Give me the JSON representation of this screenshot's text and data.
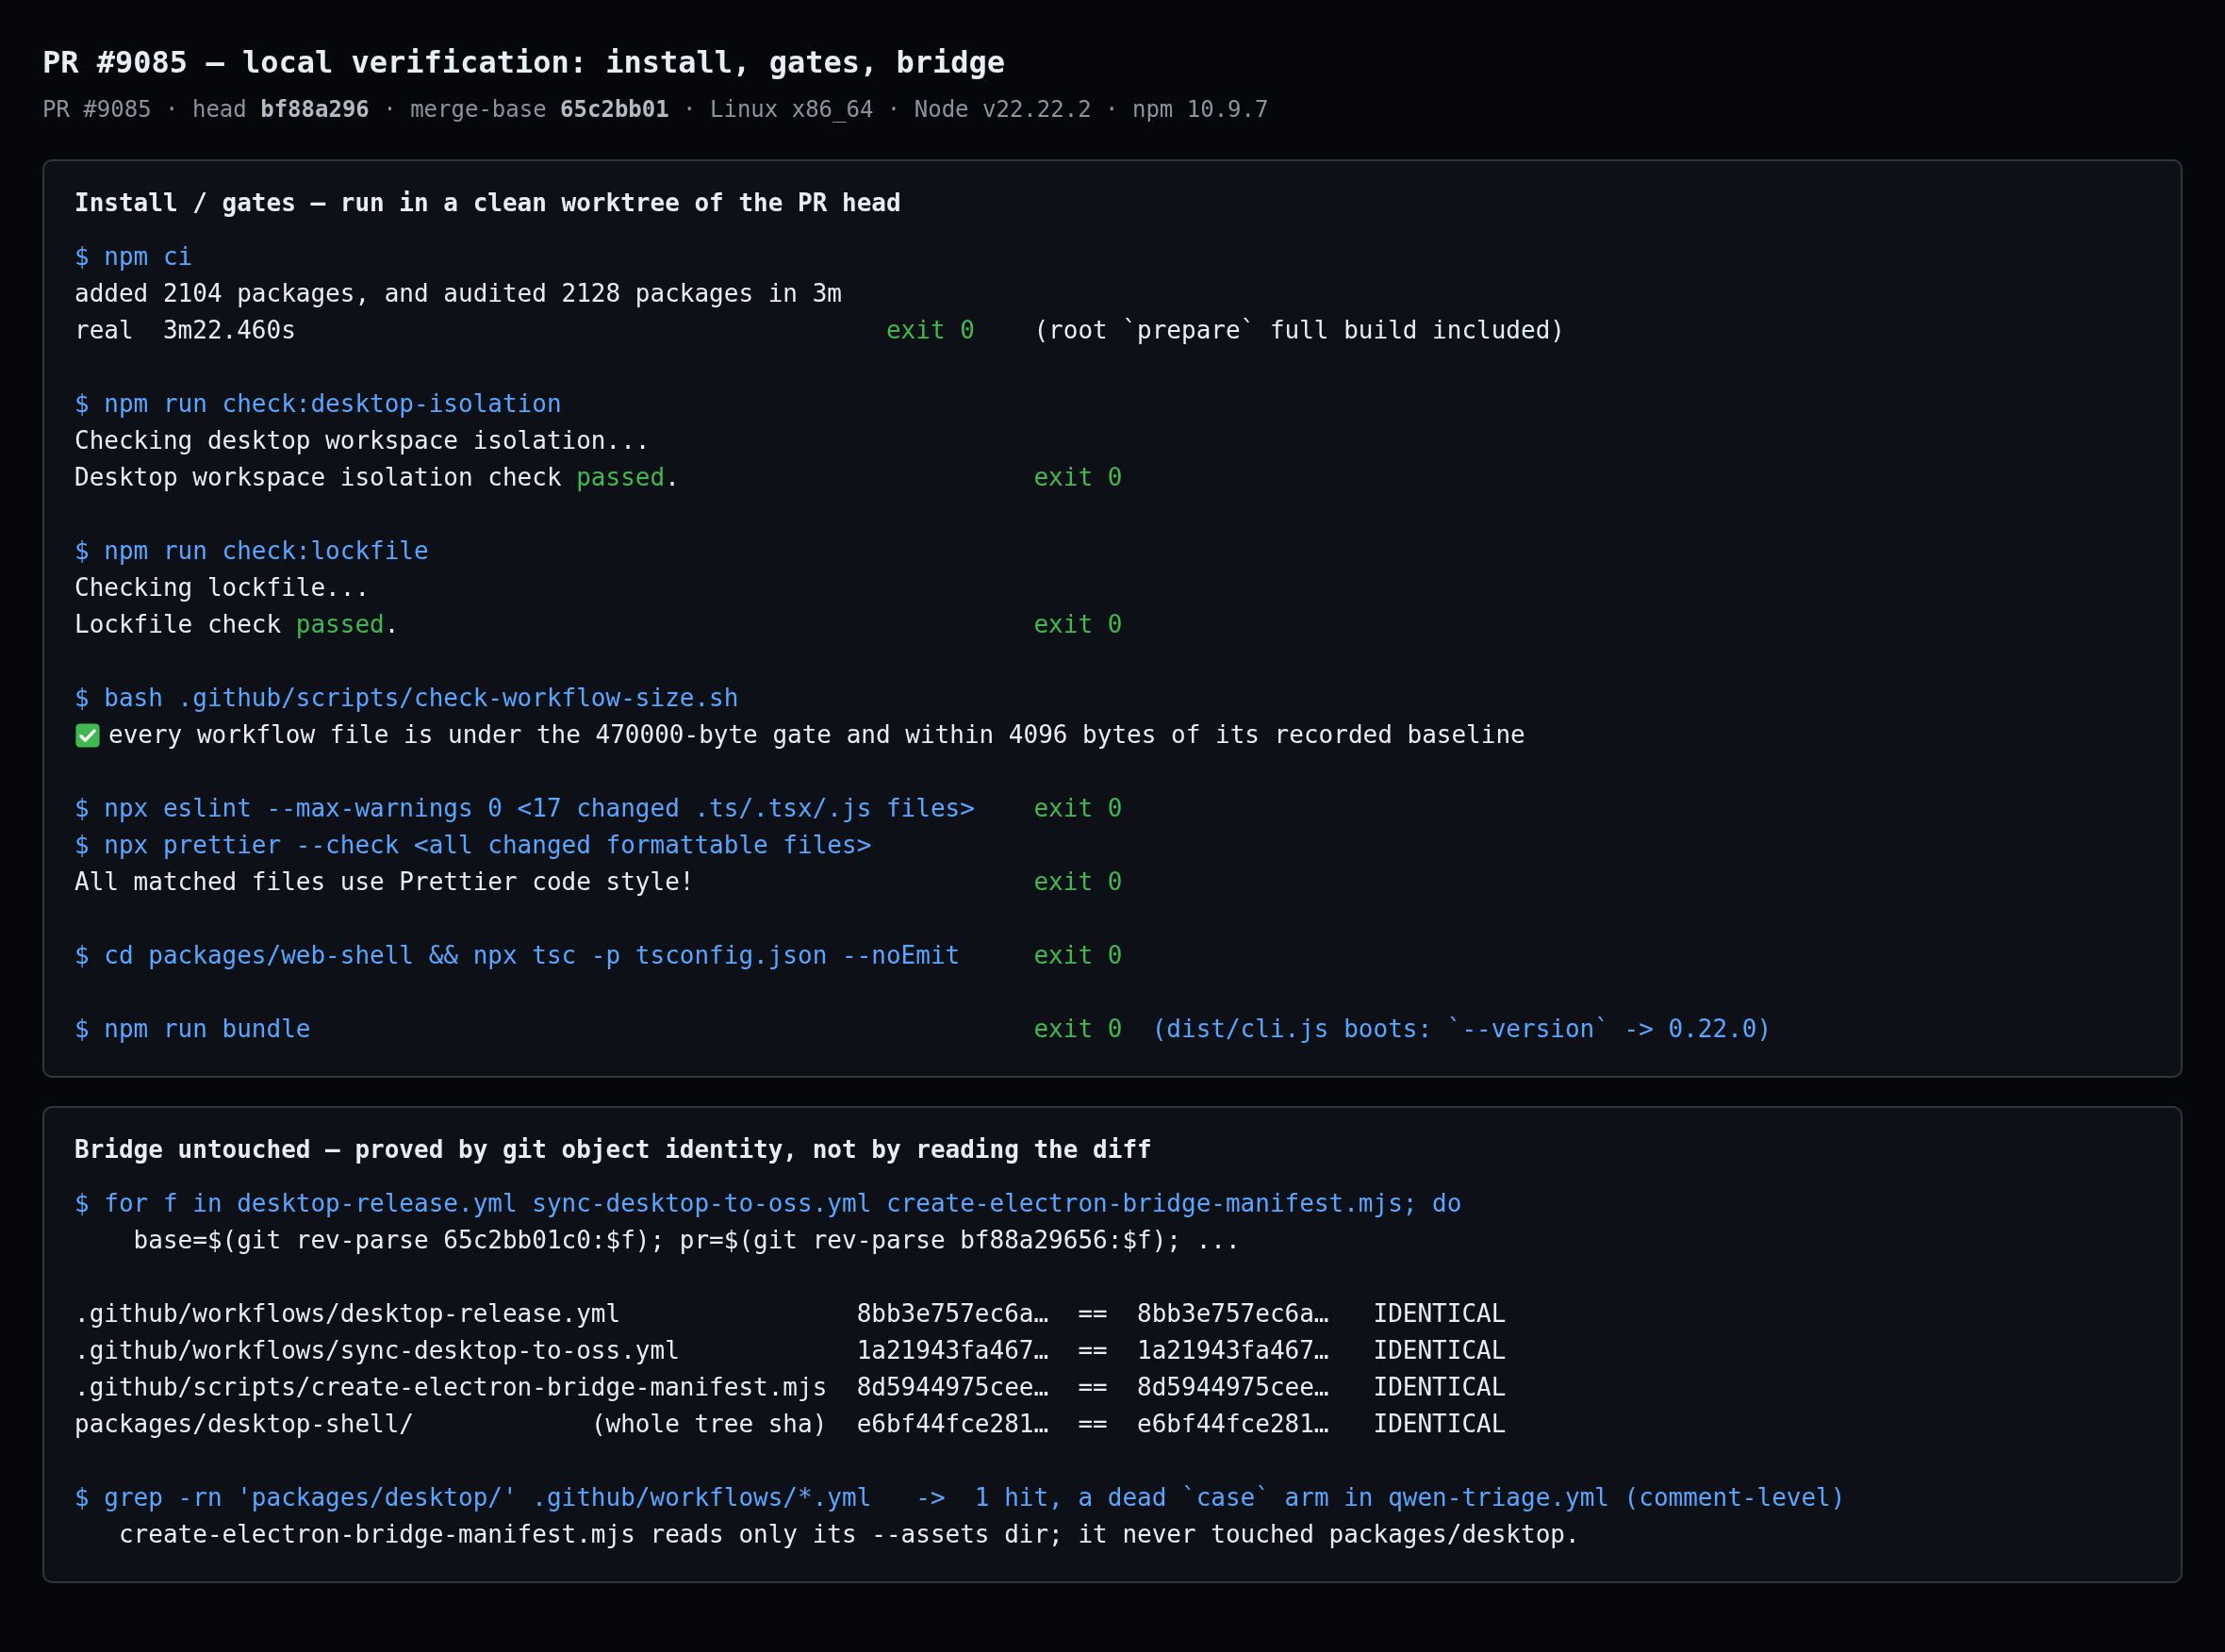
{
  "title": "PR #9085 — local verification: install, gates, bridge",
  "subtitle": "PR #9085 · head **bf88a296** · merge-base **65c2bb01** · Linux x86_64 · Node v22.22.2 · npm 10.9.7",
  "panels": [
    {
      "heading": "Install / gates — run in a clean worktree of the PR head",
      "lines": [
        {
          "kind": "flow",
          "parts": [
            {
              "text": "$ npm ci",
              "kind": "command"
            }
          ]
        },
        {
          "kind": "flow",
          "parts": [
            {
              "text": "added 2104 packages, and audited 2128 packages in 3m",
              "kind": "output"
            }
          ]
        },
        {
          "kind": "timed",
          "parts": [
            {
              "text": "real  3m22.460s",
              "kind": "output"
            }
          ],
          "status": "exit 0",
          "note": {
            "text": "(root `prepare` full build included)",
            "kind": "output"
          }
        },
        {
          "kind": "blank"
        },
        {
          "kind": "flow",
          "parts": [
            {
              "text": "$ npm run check:desktop-isolation",
              "kind": "command"
            }
          ]
        },
        {
          "kind": "flow",
          "parts": [
            {
              "text": "Checking desktop workspace isolation...",
              "kind": "output"
            }
          ]
        },
        {
          "kind": "gated",
          "parts": [
            {
              "text": "Desktop workspace isolation check ",
              "kind": "output"
            },
            {
              "text": "passed",
              "kind": "ok"
            },
            {
              "text": ".",
              "kind": "output"
            }
          ],
          "status": "exit 0"
        },
        {
          "kind": "blank"
        },
        {
          "kind": "flow",
          "parts": [
            {
              "text": "$ npm run check:lockfile",
              "kind": "command"
            }
          ]
        },
        {
          "kind": "flow",
          "parts": [
            {
              "text": "Checking lockfile...",
              "kind": "output"
            }
          ]
        },
        {
          "kind": "gated",
          "parts": [
            {
              "text": "Lockfile check ",
              "kind": "output"
            },
            {
              "text": "passed",
              "kind": "ok"
            },
            {
              "text": ".",
              "kind": "output"
            }
          ],
          "status": "exit 0"
        },
        {
          "kind": "blank"
        },
        {
          "kind": "flow",
          "parts": [
            {
              "text": "$ bash .github/scripts/check-workflow-size.sh",
              "kind": "command"
            }
          ]
        },
        {
          "kind": "checked",
          "parts": [
            {
              "text": "every workflow file is under the 470000-byte gate and within 4096 bytes of its recorded baseline",
              "kind": "output"
            }
          ]
        },
        {
          "kind": "blank"
        },
        {
          "kind": "gated",
          "parts": [
            {
              "text": "$ npx eslint --max-warnings 0 <17 changed .ts/.tsx/.js files>",
              "kind": "command"
            }
          ],
          "status": "exit 0"
        },
        {
          "kind": "flow",
          "parts": [
            {
              "text": "$ npx prettier --check <all changed formattable files>",
              "kind": "command"
            }
          ]
        },
        {
          "kind": "gated",
          "parts": [
            {
              "text": "All matched files use Prettier code style!",
              "kind": "output"
            }
          ],
          "status": "exit 0"
        },
        {
          "kind": "blank"
        },
        {
          "kind": "gated",
          "parts": [
            {
              "text": "$ cd packages/web-shell && npx tsc -p tsconfig.json --noEmit",
              "kind": "command"
            }
          ],
          "status": "exit 0"
        },
        {
          "kind": "blank"
        },
        {
          "kind": "gated",
          "parts": [
            {
              "text": "$ npm run bundle",
              "kind": "command"
            }
          ],
          "status": "exit 0",
          "note": {
            "text": "(dist/cli.js boots: `--version` -> 0.22.0)",
            "kind": "command"
          }
        }
      ]
    },
    {
      "heading": "Bridge untouched — proved by git object identity, not by reading the diff",
      "lines": [
        {
          "kind": "flow",
          "parts": [
            {
              "text": "$ for f in desktop-release.yml sync-desktop-to-oss.yml create-electron-bridge-manifest.mjs; do",
              "kind": "command"
            }
          ]
        },
        {
          "kind": "flow",
          "parts": [
            {
              "text": "    base=$(git rev-parse 65c2bb01c0:$f); pr=$(git rev-parse bf88a29656:$f); ...",
              "kind": "output"
            }
          ]
        },
        {
          "kind": "blank"
        },
        {
          "kind": "table",
          "path": ".github/workflows/desktop-release.yml",
          "base": "8bb3e757ec6a…",
          "sep": "==",
          "head": "8bb3e757ec6a…",
          "result": "IDENTICAL"
        },
        {
          "kind": "table",
          "path": ".github/workflows/sync-desktop-to-oss.yml",
          "base": "1a21943fa467…",
          "sep": "==",
          "head": "1a21943fa467…",
          "result": "IDENTICAL"
        },
        {
          "kind": "table",
          "path": ".github/scripts/create-electron-bridge-manifest.mjs",
          "base": "8d5944975cee…",
          "sep": "==",
          "head": "8d5944975cee…",
          "result": "IDENTICAL"
        },
        {
          "kind": "table",
          "path": "packages/desktop-shell/",
          "scope": "(whole tree sha)",
          "base": "e6bf44fce281…",
          "sep": "==",
          "head": "e6bf44fce281…",
          "result": "IDENTICAL"
        },
        {
          "kind": "blank"
        },
        {
          "kind": "flow",
          "parts": [
            {
              "text": "$ grep -rn 'packages/desktop/' .github/workflows/*.yml   ->  1 hit, a dead `case` arm in qwen-triage.yml (comment-level)",
              "kind": "command"
            }
          ]
        },
        {
          "kind": "flow",
          "parts": [
            {
              "text": "   create-electron-bridge-manifest.mjs reads only its --assets dir; it never touched packages/desktop.",
              "kind": "output"
            }
          ]
        }
      ]
    }
  ]
}
